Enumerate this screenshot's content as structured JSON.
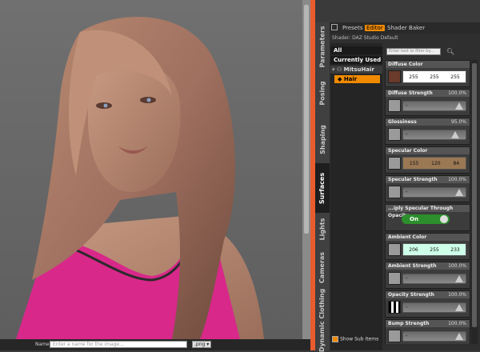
{
  "bottom": {
    "name_label": "Name",
    "name_placeholder": "Enter a name for the image...",
    "format": ".png"
  },
  "vertical_tabs": [
    "Parameters",
    "Posing",
    "Shaping",
    "Surfaces",
    "Lights",
    "Cameras",
    "Dynamic Clothing"
  ],
  "top_tabs": [
    "Presets",
    "Editor",
    "Shader Baker"
  ],
  "shader_label": "Shader: DAZ Studio Default",
  "tree": {
    "all": "All",
    "currently_used": "Currently Used",
    "node": "MitsuHair",
    "child": "Hair"
  },
  "filter_placeholder": "Enter text to filter by...",
  "properties": [
    {
      "label": "Diffuse Color",
      "type": "color",
      "values": [
        "255",
        "255",
        "255"
      ],
      "swatch": "#6a3a2a",
      "field": "#ffffff"
    },
    {
      "label": "Diffuse Strength",
      "type": "slider",
      "value": "100.0%"
    },
    {
      "label": "Glossiness",
      "type": "slider",
      "value": "95.0%"
    },
    {
      "label": "Specular Color",
      "type": "color",
      "values": [
        "155",
        "120",
        "84"
      ],
      "swatch": "#9b7854",
      "field": "#9b7854"
    },
    {
      "label": "Specular Strength",
      "type": "slider",
      "value": "100.0%"
    },
    {
      "label": "...iply Specular Through Opacity",
      "type": "toggle",
      "value": "On"
    },
    {
      "label": "Ambient Color",
      "type": "color",
      "values": [
        "206",
        "255",
        "233"
      ],
      "swatch": "#9a9a9a",
      "field": "#ceffe9"
    },
    {
      "label": "Ambient Strength",
      "type": "slider",
      "value": "100.0%"
    },
    {
      "label": "Opacity Strength",
      "type": "slider",
      "value": "100.0%"
    },
    {
      "label": "Bump Strength",
      "type": "slider",
      "value": "100.0%"
    }
  ],
  "show_sub_items": "Show Sub Items",
  "colors": {
    "accent": "#ea5b2e",
    "active_tab": "#f08a00",
    "toggle_on": "#2c8e2c"
  }
}
